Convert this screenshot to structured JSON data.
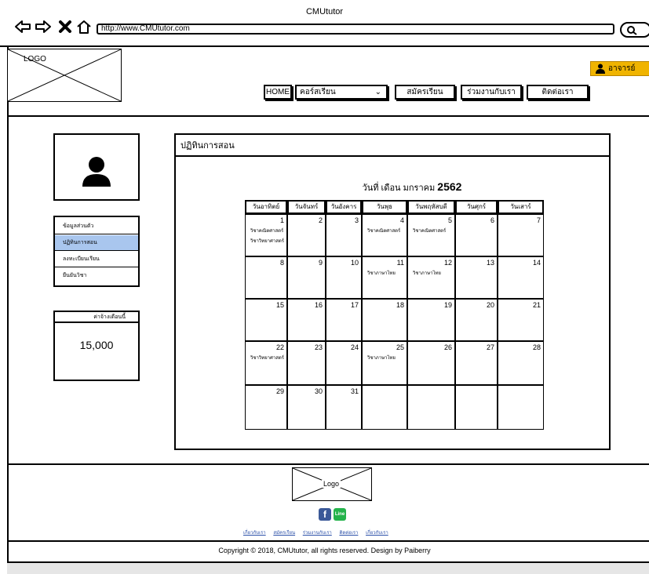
{
  "window": {
    "title": "CMUtutor",
    "url": "http://www.CMUtutor.com"
  },
  "header": {
    "logo_text": "LOGO",
    "user_button": "อาจารย์",
    "menu": {
      "home": "HOME",
      "course": "คอร์สเรียน",
      "register": "สมัครเรียน",
      "join": "ร่วมงานกับเรา",
      "contact": "ติดต่อเรา"
    }
  },
  "sidebar": {
    "items": [
      {
        "label": "ข้อมูลส่วนตัว",
        "active": false
      },
      {
        "label": "ปฏิทินการสอน",
        "active": true
      },
      {
        "label": "ลงทะเบียนเรียน",
        "active": false
      },
      {
        "label": "ยืนยันวิชา",
        "active": false
      }
    ],
    "salary_label": "ค่าจ้างเดือนนี้",
    "salary_value": "15,000"
  },
  "main": {
    "title": "ปฏิทินการสอน",
    "date_prefix": "วันที่  เดือน  มกราคม",
    "year": "2562"
  },
  "calendar": {
    "weekdays": [
      "วันอาทิตย์",
      "วันจันทร์",
      "วันอังคาร",
      "วันพุธ",
      "วันพฤหัสบดี",
      "วันศุกร์",
      "วันเสาร์"
    ],
    "weeks": [
      [
        {
          "d": "1",
          "ev": [
            "วิชาคณิตศาสตร์",
            "วิชาวิทยาศาสตร์"
          ]
        },
        {
          "d": "2",
          "ev": []
        },
        {
          "d": "3",
          "ev": []
        },
        {
          "d": "4",
          "ev": [
            "วิชาคณิตศาสตร์"
          ]
        },
        {
          "d": "5",
          "ev": [
            "วิชาคณิตศาสตร์"
          ]
        },
        {
          "d": "6",
          "ev": []
        },
        {
          "d": "7",
          "ev": []
        }
      ],
      [
        {
          "d": "8",
          "ev": []
        },
        {
          "d": "9",
          "ev": []
        },
        {
          "d": "10",
          "ev": []
        },
        {
          "d": "11",
          "ev": [
            "วิชาภาษาไทย"
          ]
        },
        {
          "d": "12",
          "ev": [
            "วิชาภาษาไทย"
          ]
        },
        {
          "d": "13",
          "ev": []
        },
        {
          "d": "14",
          "ev": []
        }
      ],
      [
        {
          "d": "15",
          "ev": []
        },
        {
          "d": "16",
          "ev": []
        },
        {
          "d": "17",
          "ev": []
        },
        {
          "d": "18",
          "ev": []
        },
        {
          "d": "19",
          "ev": []
        },
        {
          "d": "20",
          "ev": []
        },
        {
          "d": "21",
          "ev": []
        }
      ],
      [
        {
          "d": "22",
          "ev": [
            "วิชาวิทยาศาสตร์"
          ]
        },
        {
          "d": "23",
          "ev": []
        },
        {
          "d": "24",
          "ev": []
        },
        {
          "d": "25",
          "ev": [
            "วิชาภาษาไทย"
          ]
        },
        {
          "d": "26",
          "ev": []
        },
        {
          "d": "27",
          "ev": []
        },
        {
          "d": "28",
          "ev": []
        }
      ],
      [
        {
          "d": "29",
          "ev": []
        },
        {
          "d": "30",
          "ev": []
        },
        {
          "d": "31",
          "ev": []
        },
        {
          "d": "",
          "ev": []
        },
        {
          "d": "",
          "ev": []
        },
        {
          "d": "",
          "ev": []
        },
        {
          "d": "",
          "ev": []
        }
      ]
    ]
  },
  "footer": {
    "logo_text": "Logo",
    "line_label": "Line",
    "links": [
      "เกี่ยวกับเรา",
      "สมัครเรียน",
      "ร่วมงานกับเรา",
      "ติดต่อเรา",
      "เกี่ยวกับเรา"
    ],
    "copyright": "Copyright © 2018, CMUtutor, all rights reserved. Design by Paiberry"
  },
  "colors": {
    "user_button": "#f0b400",
    "active_item": "#a9c6ee",
    "facebook": "#3b5998",
    "line": "#24b34b",
    "link": "#2a4fa8"
  }
}
